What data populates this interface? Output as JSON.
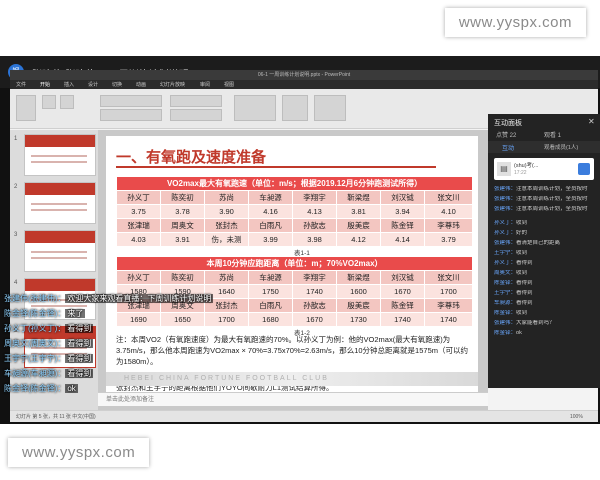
{
  "watermark": {
    "top": "www.yyspx.com",
    "bottom": "www.yyspx.com"
  },
  "live": {
    "avatar": "钢",
    "title": "张建伟(张建伟)：下周训练计划说明"
  },
  "ppt": {
    "window_title": "06-1 一周训练计划说明.pptx - PowerPoint",
    "tabs": [
      "文件",
      "开始",
      "插入",
      "设计",
      "切换",
      "动画",
      "幻灯片放映",
      "审阅",
      "视图"
    ],
    "notes_placeholder": "单击此处添加备注",
    "status": "幻灯片 第 5 张，共 11 张   中文(中国)",
    "zoom": "100%",
    "thumbnail_numbers": [
      "1",
      "2",
      "3",
      "4",
      "5"
    ]
  },
  "slide": {
    "title": "一、有氧跑及速度准备",
    "table1": {
      "header": "VO2max最大有氧跑速（单位：m/s；根据2019.12月6分钟跑测试所得）",
      "rows": [
        [
          "孙义丁",
          "陈奕初",
          "苏尚",
          "车昶源",
          "李翔宇",
          "靳梁煜",
          "刘汉钺",
          "张文川"
        ],
        [
          "3.75",
          "3.78",
          "3.90",
          "4.16",
          "4.13",
          "3.81",
          "3.94",
          "4.10"
        ],
        [
          "张津瑞",
          "周奥文",
          "张封杰",
          "白雨凡",
          "孙歆志",
          "殷美宸",
          "陈金铎",
          "李尊玮"
        ],
        [
          "4.03",
          "3.91",
          "伤，未测",
          "3.99",
          "3.98",
          "4.12",
          "4.14",
          "3.79"
        ]
      ],
      "caption": "表1-1"
    },
    "table2": {
      "header": "本周10分钟应跑距离（单位：m；70%VO2max）",
      "rows": [
        [
          "孙义丁",
          "陈奕初",
          "苏尚",
          "车昶源",
          "李翔宇",
          "靳梁煜",
          "刘汉钺",
          "张文川"
        ],
        [
          "1580",
          "1590",
          "1640",
          "1750",
          "1740",
          "1600",
          "1670",
          "1700"
        ],
        [
          "张津瑞",
          "周奥文",
          "张封杰",
          "白雨凡",
          "孙歆志",
          "殷美宸",
          "陈金铎",
          "李尊玮"
        ],
        [
          "1690",
          "1650",
          "1700",
          "1680",
          "1670",
          "1730",
          "1740",
          "1740"
        ]
      ],
      "caption": "表1-2"
    },
    "note1": "注：本周VO2（有氧跑速度）为最大有氧跑速的70%。以孙义丁为例：他的VO2max(最大有氧跑速)为3.75m/s，那么他本周跑速为VO2max × 70%=3.75x70%=2.63m/s，那么10分钟总距离就是1575m（可以约为1580m）。",
    "note2": "张封杰和王宇宁的距离根据他们YOYO间歇耐力L1测试结算所得。",
    "club_band": "HEBEI CHINA FORTUNE FOOTBALL CLUB"
  },
  "panel": {
    "title": "互动面板",
    "close": "✕",
    "likes": "点赞 22",
    "views": "观看 1",
    "tabs": [
      "互动",
      "观看成员(1人)"
    ],
    "pinned": {
      "text": "(shu)考(...",
      "time": "17:22"
    },
    "messages": [
      {
        "name": "张建伟：",
        "text": "注意本周训练计划，全员按时"
      },
      {
        "name": "张建伟：",
        "text": "注意本周训练计划，全员按时"
      },
      {
        "name": "张建伟：",
        "text": "注意本周训练计划，全员按时"
      },
      {
        "name": "孙义丁：",
        "text": "收到"
      },
      {
        "name": "孙义丁：",
        "text": "好的"
      },
      {
        "name": "张建伟：",
        "text": "看清楚自己的距离"
      },
      {
        "name": "王宇宁：",
        "text": "收到"
      },
      {
        "name": "孙义丁：",
        "text": "看得到"
      },
      {
        "name": "周奥文：",
        "text": "收到"
      },
      {
        "name": "陈金铎：",
        "text": "看得到"
      },
      {
        "name": "王宇宁：",
        "text": "看得到"
      },
      {
        "name": "车昶源：",
        "text": "看得到"
      },
      {
        "name": "陈金铎：",
        "text": "收到"
      },
      {
        "name": "张建伟：",
        "text": "大家能看到吗？"
      },
      {
        "name": "陈金铎：",
        "text": "ok"
      }
    ]
  },
  "chat": [
    {
      "name": "张建伟(张建伟)：",
      "text": "欢迎大家来观看直播：下周训练计划说明"
    },
    {
      "name": "陈金铎(陈金铎)：",
      "text": "来了"
    },
    {
      "name": "孙义丁(孙义丁)：",
      "text": "看得到"
    },
    {
      "name": "周奥文(周奥文)：",
      "text": "看得到"
    },
    {
      "name": "王宇宁(王宇宁)：",
      "text": "看得到"
    },
    {
      "name": "车昶源(车昶源)：",
      "text": "看得到"
    },
    {
      "name": "陈金铎(陈金铎)：",
      "text": "ok"
    }
  ]
}
